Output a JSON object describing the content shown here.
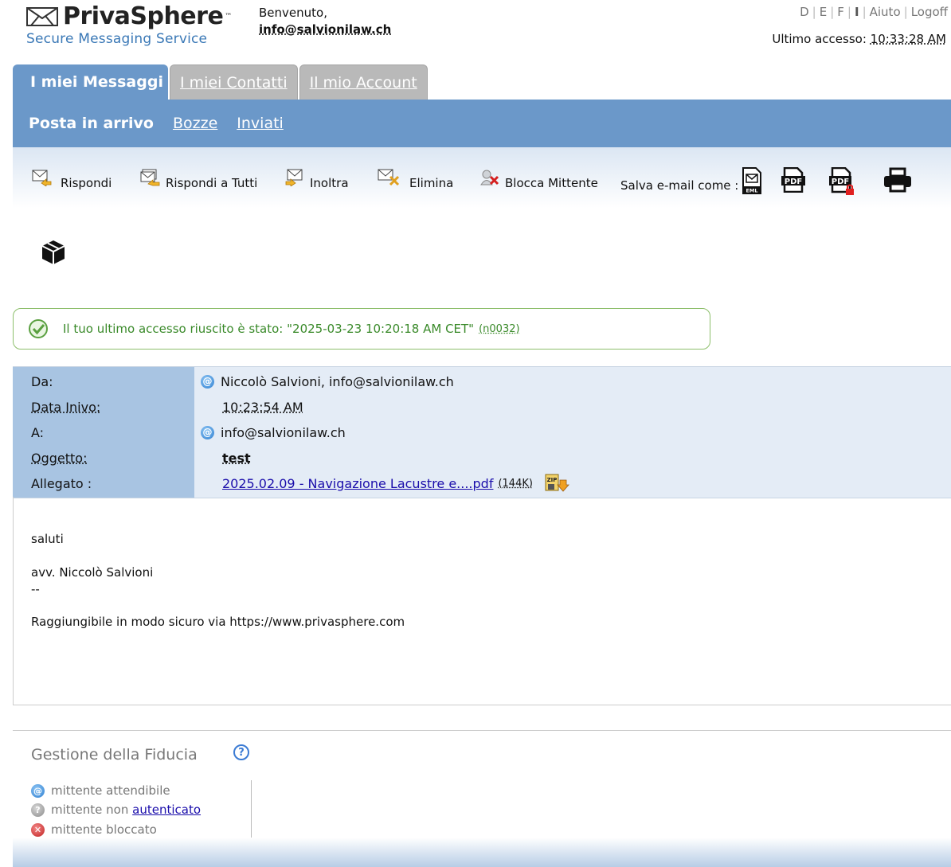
{
  "header": {
    "logo_name": "PrivaSphere",
    "logo_tm": "™",
    "logo_tagline": "Secure Messaging Service",
    "welcome": "Benvenuto,",
    "user": "info@salvionilaw.ch",
    "lang_links": [
      "D",
      "E",
      "F",
      "I"
    ],
    "help_link": "Aiuto",
    "logoff_link": "Logoff",
    "last_access_label": "Ultimo accesso:",
    "last_access_time": "10:33:28 AM"
  },
  "tabs": [
    "I miei Messaggi",
    "I miei Contatti",
    "Il mio Account"
  ],
  "subnav": {
    "current": "Posta in arrivo",
    "links": [
      "Bozze",
      "Inviati"
    ]
  },
  "toolbar": {
    "reply": "Rispondi",
    "reply_all": "Rispondi a Tutti",
    "forward": "Inoltra",
    "delete": "Elimina",
    "block": "Blocca Mittente",
    "save_as": "Salva e-mail come :"
  },
  "status": {
    "text": "Il tuo ultimo accesso riuscito è stato: \"2025-03-23 10:20:18 AM CET\"",
    "code": "(n0032)"
  },
  "message": {
    "from_label": "Da:",
    "from_value": "Niccolò Salvioni, info@salvionilaw.ch",
    "date_label": "Data Inivo:",
    "date_value": "10:23:54 AM",
    "to_label": "A:",
    "to_value": "info@salvionilaw.ch",
    "subject_label": "Oggetto:",
    "subject_value": "test",
    "attachment_label": "Allegato :",
    "attachment_name": "2025.02.09 - Navigazione Lacustre e....pdf",
    "attachment_size": "(144K)",
    "body": [
      "saluti",
      "avv. Niccolò Salvioni",
      "--",
      "Raggiungibile in modo sicuro via https://www.privasphere.com"
    ]
  },
  "trust": {
    "title": "Gestione della Fiducia",
    "trusted": "mittente attendibile",
    "unauth_prefix": "mittente non",
    "unauth_link": "autenticato",
    "blocked": "mittente bloccato"
  }
}
